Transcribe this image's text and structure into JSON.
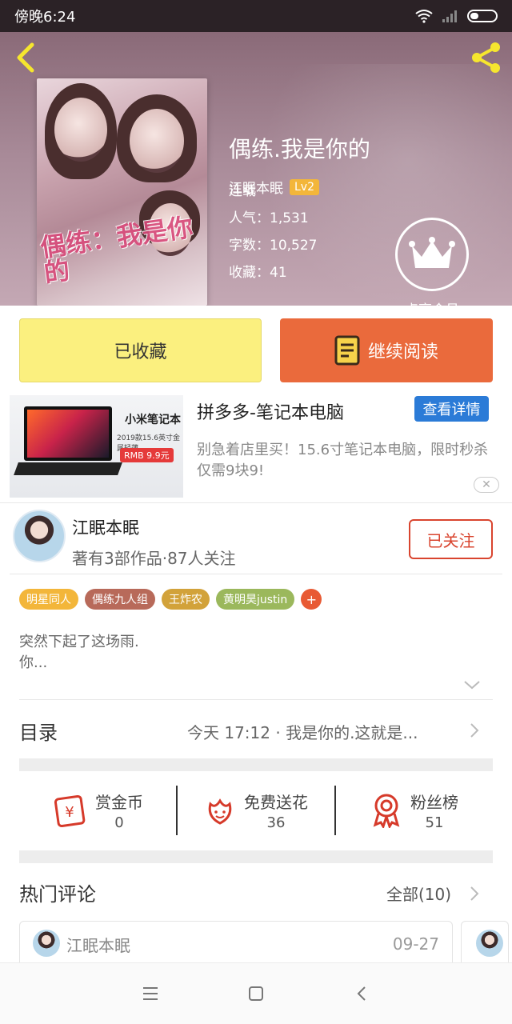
{
  "status_bar": {
    "time": "傍晚6:24"
  },
  "book": {
    "title": "偶练.我是你的",
    "author": "江眠本眠",
    "author_level": "Lv2",
    "status": "连载",
    "popularity": "人气：1,531",
    "word_count": "字数：10,527",
    "favorites": "收藏：41",
    "cover_title": "偶练：我是你的"
  },
  "vip": {
    "label": "点亮会员"
  },
  "actions": {
    "collected_label": "已收藏",
    "continue_label": "继续阅读"
  },
  "ad": {
    "title": "拼多多-笔记本电脑",
    "detail_button": "查看详情",
    "description": "别急着店里买！15.6寸笔记本电脑，限时秒杀仅需9块9!",
    "close": "✕",
    "image_title": "小米笔记本",
    "image_subtitle": "2019款15.6英寸金属轻薄",
    "image_price": "RMB 9.9元"
  },
  "author": {
    "name": "江眠本眠",
    "stats": "著有3部作品·87人关注",
    "follow_label": "已关注"
  },
  "tags": [
    {
      "label": "明星同人",
      "color": "#f3b63a"
    },
    {
      "label": "偶练九人组",
      "color": "#b86a5a"
    },
    {
      "label": "王炸农",
      "color": "#d2a23a"
    },
    {
      "label": "黄明昊justin",
      "color": "#9bb85c"
    }
  ],
  "tag_add": "+",
  "summary": {
    "line1": "突然下起了这场雨.",
    "line2": "你..."
  },
  "catalog": {
    "label": "目录",
    "latest": "今天 17:12 · 我是你的.这就是..."
  },
  "stats": [
    {
      "label": "赏金币",
      "value": "0"
    },
    {
      "label": "免费送花",
      "value": "36"
    },
    {
      "label": "粉丝榜",
      "value": "51"
    }
  ],
  "comments": {
    "title": "热门评论",
    "all_label": "全部(10)",
    "items": [
      {
        "user": "江眠本眠",
        "date": "09-27"
      }
    ]
  },
  "colors": {
    "accent": "#ea6a3c",
    "collected_bg": "#fbf07f",
    "follow": "#d9452f",
    "ad_button": "#2b7bd7"
  }
}
